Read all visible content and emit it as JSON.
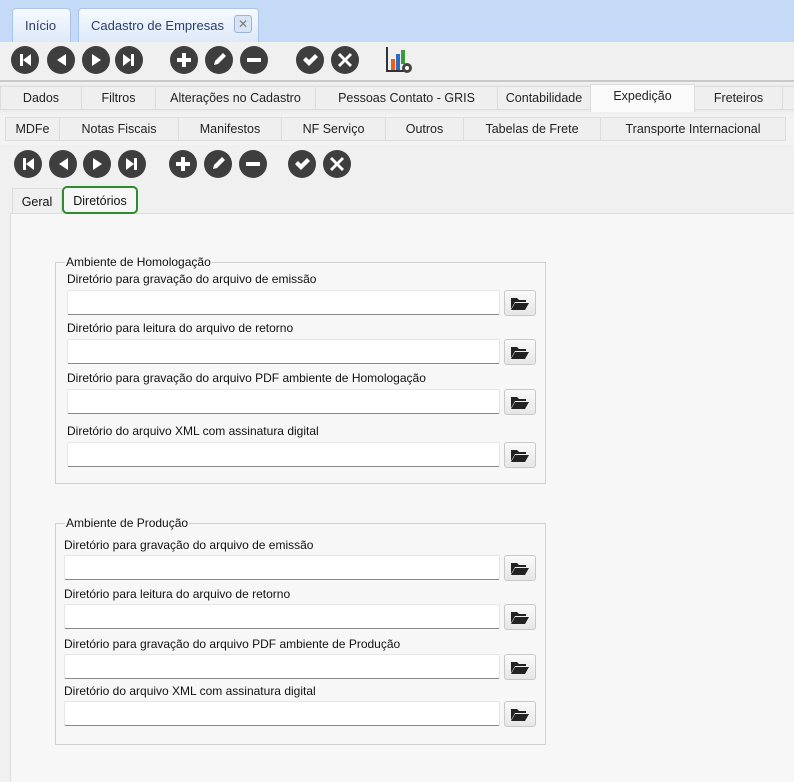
{
  "window_tabs": [
    {
      "label": "Início"
    },
    {
      "label": "Cadastro de Empresas"
    }
  ],
  "main_tabs": [
    "Dados",
    "Filtros",
    "Alterações no Cadastro",
    "Pessoas Contato - GRIS",
    "Contabilidade",
    "Expedição",
    "Freteiros"
  ],
  "sub_tabs": [
    "MDFe",
    "Notas Fiscais",
    "Manifestos",
    "NF Serviço",
    "Outros",
    "Tabelas de Frete",
    "Transporte Internacional"
  ],
  "inner_tabs": [
    "Geral",
    "Diretórios"
  ],
  "selected": {
    "main_tab": "Expedição",
    "inner_tab": "Diretórios"
  },
  "groups": [
    {
      "title": "Ambiente de Homologação",
      "fields": [
        {
          "label": "Diretório para gravação do arquivo de emissão",
          "value": ""
        },
        {
          "label": "Diretório para leitura do arquivo de retorno",
          "value": ""
        },
        {
          "label": "Diretório para gravação do arquivo PDF ambiente de Homologação",
          "value": ""
        },
        {
          "label": "Diretório do arquivo XML com assinatura digital",
          "value": ""
        }
      ]
    },
    {
      "title": "Ambiente de Produção",
      "fields": [
        {
          "label": "Diretório para gravação do arquivo de emissão",
          "value": ""
        },
        {
          "label": "Diretório para leitura do arquivo de retorno",
          "value": ""
        },
        {
          "label": "Diretório para gravação do arquivo PDF ambiente de Produção",
          "value": ""
        },
        {
          "label": "Diretório do arquivo XML com assinatura digital",
          "value": ""
        }
      ]
    }
  ],
  "colors": {
    "accent_green": "#2e8b2e",
    "icon_dark": "#3e3e3e",
    "tab_strip": "#c4daf7"
  }
}
